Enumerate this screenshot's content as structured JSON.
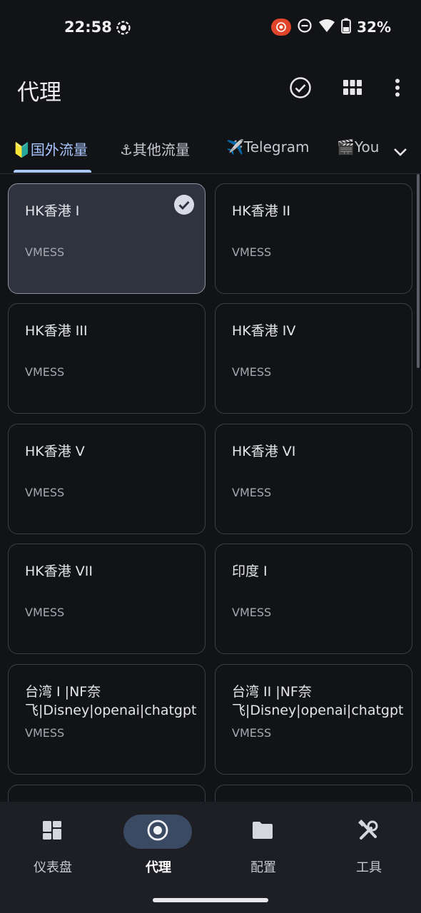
{
  "status_bar": {
    "time": "22:58",
    "battery": "32%",
    "icons": [
      "screen-record-icon",
      "cast-icon",
      "dnd-icon",
      "wifi-icon",
      "battery-icon"
    ]
  },
  "app_bar": {
    "title": "代理",
    "actions": [
      "check-circle-icon",
      "grid-view-icon",
      "more-vert-icon"
    ]
  },
  "tabs": {
    "items": [
      {
        "label": "🔰国外流量",
        "active": true
      },
      {
        "label": "⚓其他流量",
        "active": false
      },
      {
        "label": "✈️Telegram",
        "active": false
      },
      {
        "label": "🎬You",
        "active": false
      }
    ],
    "accent": "#aac7ff"
  },
  "proxies": [
    {
      "name": "HK香港 I",
      "type": "VMESS",
      "selected": true
    },
    {
      "name": "HK香港 II",
      "type": "VMESS",
      "selected": false
    },
    {
      "name": "HK香港 III",
      "type": "VMESS",
      "selected": false
    },
    {
      "name": "HK香港 IV",
      "type": "VMESS",
      "selected": false
    },
    {
      "name": "HK香港 V",
      "type": "VMESS",
      "selected": false
    },
    {
      "name": "HK香港 VI",
      "type": "VMESS",
      "selected": false
    },
    {
      "name": "HK香港 VII",
      "type": "VMESS",
      "selected": false
    },
    {
      "name": "印度 I",
      "type": "VMESS",
      "selected": false
    },
    {
      "name": "台湾 I |NF奈飞|Disney|openai|chatgpt",
      "type": "VMESS",
      "selected": false
    },
    {
      "name": "台湾 II |NF奈飞|Disney|openai|chatgpt",
      "type": "VMESS",
      "selected": false
    },
    {
      "name": "",
      "type": "",
      "selected": false
    },
    {
      "name": "",
      "type": "",
      "selected": false
    }
  ],
  "bottom_nav": {
    "items": [
      {
        "label": "仪表盘",
        "icon": "dashboard-icon",
        "active": false
      },
      {
        "label": "代理",
        "icon": "radio-button-icon",
        "active": true
      },
      {
        "label": "配置",
        "icon": "folder-icon",
        "active": false
      },
      {
        "label": "工具",
        "icon": "tools-icon",
        "active": false
      }
    ]
  },
  "colors": {
    "background": "#121316",
    "selected_card": "#2f3340",
    "nav_background": "#1d1f24",
    "active_pill": "#3a4a63"
  }
}
